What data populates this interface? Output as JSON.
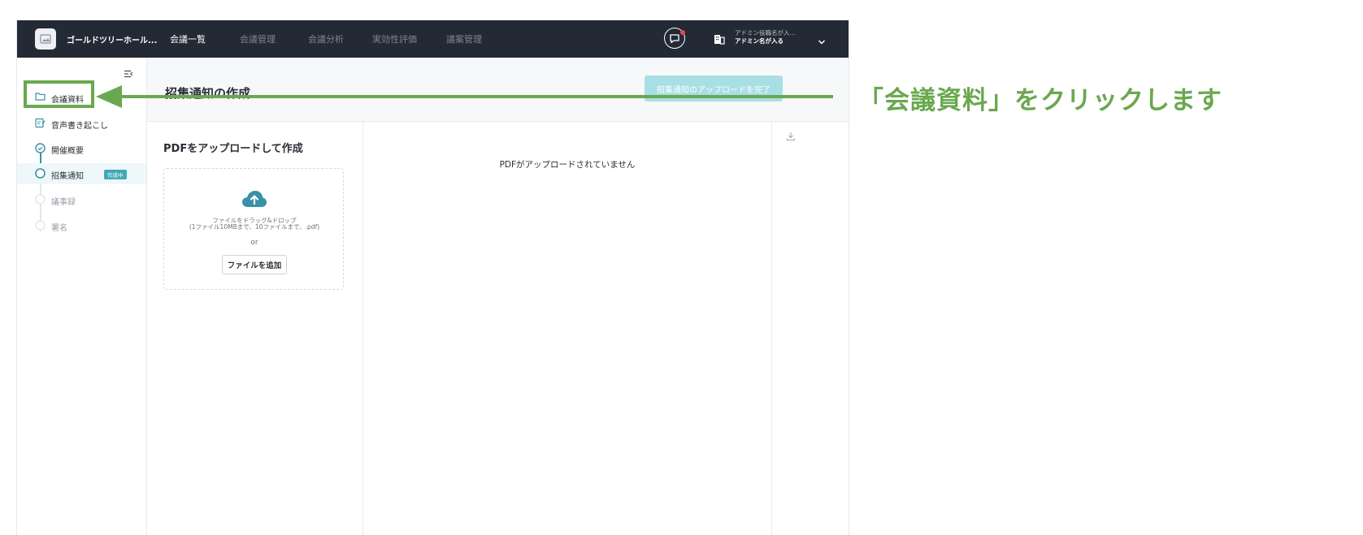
{
  "topbar": {
    "org_name": "ゴールドツリーホール...",
    "nav": [
      "会議一覧",
      "会議管理",
      "会議分析",
      "実効性評価",
      "議案管理"
    ],
    "active_nav": "会議一覧",
    "admin_role": "アドミン役職名が入...",
    "admin_name": "アドミン名が入る",
    "icons": [
      "image-placeholder-icon",
      "chat-icon",
      "building-icon",
      "chevron-down-icon"
    ]
  },
  "sidebar": {
    "items": [
      {
        "label": "会議資料",
        "icon": "folder-icon"
      },
      {
        "label": "音声書き起こし",
        "icon": "transcript-icon"
      },
      {
        "label": "開催概要",
        "icon": "check-circle-icon"
      },
      {
        "label": "招集通知",
        "icon": "circle-icon",
        "badge": "作成中"
      },
      {
        "label": "議事録",
        "icon": "circle-icon"
      },
      {
        "label": "署名",
        "icon": "circle-icon"
      }
    ]
  },
  "header": {
    "title": "招集通知の作成",
    "complete_button": "招集通知のアップロードを完了"
  },
  "upload": {
    "title": "PDFをアップロードして作成",
    "drop_text_1": "ファイルをドラッグ&ドロップ",
    "drop_text_2": "(1ファイル10MBまで、10ファイルまで、.pdf)",
    "or": "or",
    "add_button": "ファイルを追加"
  },
  "preview": {
    "empty_message": "PDFがアップロードされていません"
  },
  "annotation": {
    "callout": "「会議資料」をクリックします",
    "color": "#6aa84f"
  },
  "colors": {
    "topbar_bg": "#232a35",
    "accent": "#3fa9b8",
    "button_disabled": "#a8dfe4"
  }
}
